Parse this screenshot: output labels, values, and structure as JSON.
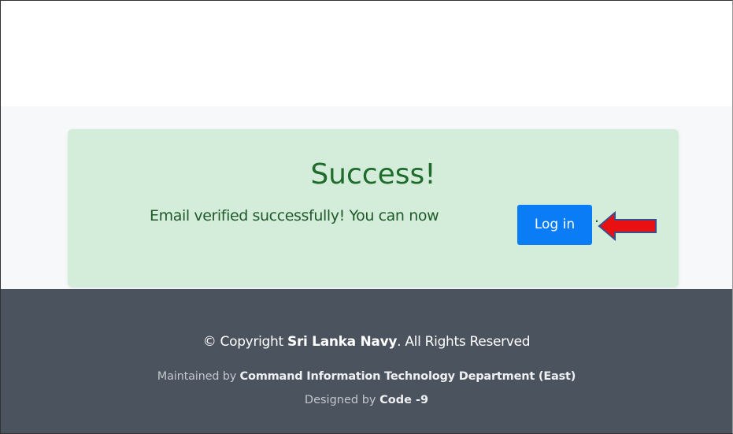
{
  "alert": {
    "title": "Success!",
    "message": "Email verified successfully! You can now",
    "button_label": "Log in",
    "trailing": ".",
    "background": "#d4edda",
    "button_color": "#0a7cf5",
    "annotation_icon": "red-arrow-icon"
  },
  "footer": {
    "copyright_prefix": "© Copyright",
    "copyright_org": "Sri Lanka Navy",
    "copyright_suffix": ". All Rights Reserved",
    "maintained_prefix": "Maintained by",
    "maintained_org": "Command Information Technology Department (East)",
    "designed_prefix": "Designed by",
    "designed_team": "Code -9",
    "background": "#4b535e"
  }
}
